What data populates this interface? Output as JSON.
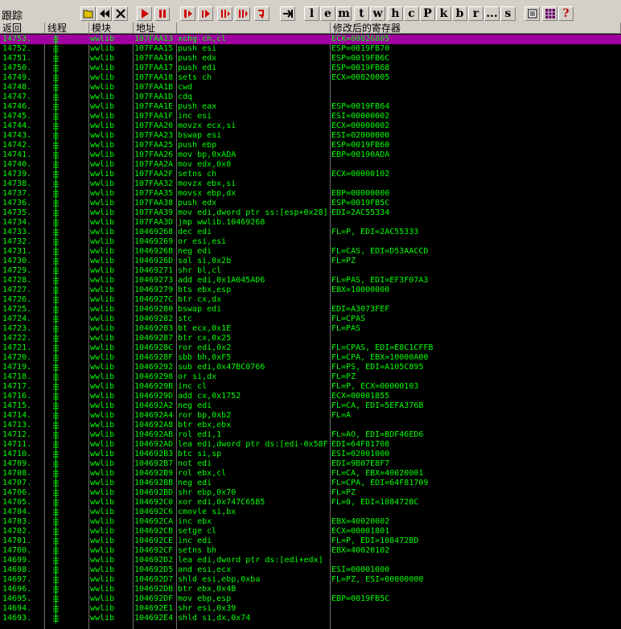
{
  "window": {
    "title": "跟踪"
  },
  "toolbar": {
    "letters": [
      "l",
      "e",
      "m",
      "t",
      "w",
      "h",
      "c",
      "P",
      "k",
      "b",
      "r",
      "...",
      "s"
    ],
    "help": "?"
  },
  "columns": {
    "index": "返回",
    "thread": "线程",
    "module": "模块",
    "address": "地址",
    "instruction": "",
    "registers": "修改后的寄存器"
  },
  "rows": [
    {
      "i": "14753.",
      "m": "wwlib",
      "a": "107FAA13",
      "ins": "xchg ch,cl",
      "reg": "ECX=00826805",
      "sel": true
    },
    {
      "i": "14752.",
      "m": "wwlib",
      "a": "107FAA15",
      "ins": "push esi",
      "reg": "ESP=0019FB70"
    },
    {
      "i": "14751.",
      "m": "wwlib",
      "a": "107FAA16",
      "ins": "push edx",
      "reg": "ESP=0019FB6C"
    },
    {
      "i": "14750.",
      "m": "wwlib",
      "a": "107FAA17",
      "ins": "push edi",
      "reg": "ESP=0019FB68"
    },
    {
      "i": "14749.",
      "m": "wwlib",
      "a": "107FAA18",
      "ins": "sets ch",
      "reg": "ECX=00820005"
    },
    {
      "i": "14748.",
      "m": "wwlib",
      "a": "107FAA1B",
      "ins": "cwd",
      "reg": ""
    },
    {
      "i": "14747.",
      "m": "wwlib",
      "a": "107FAA1D",
      "ins": "cdq",
      "reg": ""
    },
    {
      "i": "14746.",
      "m": "wwlib",
      "a": "107FAA1E",
      "ins": "push eax",
      "reg": "ESP=0019FB64"
    },
    {
      "i": "14745.",
      "m": "wwlib",
      "a": "107FAA1F",
      "ins": "inc esi",
      "reg": "ESI=00000002"
    },
    {
      "i": "14744.",
      "m": "wwlib",
      "a": "107FAA20",
      "ins": "movzx ecx,si",
      "reg": "ECX=00000002"
    },
    {
      "i": "14743.",
      "m": "wwlib",
      "a": "107FAA23",
      "ins": "bswap esi",
      "reg": "ESI=02000000"
    },
    {
      "i": "14742.",
      "m": "wwlib",
      "a": "107FAA25",
      "ins": "push ebp",
      "reg": "ESP=0019FB60"
    },
    {
      "i": "14741.",
      "m": "wwlib",
      "a": "107FAA26",
      "ins": "mov bp,0xADA",
      "reg": "EBP=00190ADA"
    },
    {
      "i": "14740.",
      "m": "wwlib",
      "a": "107FAA2A",
      "ins": "mov edx,0x0",
      "reg": ""
    },
    {
      "i": "14739.",
      "m": "wwlib",
      "a": "107FAA2F",
      "ins": "setns ch",
      "reg": "ECX=00000102"
    },
    {
      "i": "14738.",
      "m": "wwlib",
      "a": "107FAA32",
      "ins": "movzx ebx,si",
      "reg": ""
    },
    {
      "i": "14737.",
      "m": "wwlib",
      "a": "107FAA35",
      "ins": "movsx ebp,dx",
      "reg": "EBP=00000000"
    },
    {
      "i": "14736.",
      "m": "wwlib",
      "a": "107FAA38",
      "ins": "push edx",
      "reg": "ESP=0019FB5C"
    },
    {
      "i": "14735.",
      "m": "wwlib",
      "a": "107FAA39",
      "ins": "mov edi,dword ptr ss:[esp+0x28]",
      "reg": "EDI=2AC55334"
    },
    {
      "i": "14734.",
      "m": "wwlib",
      "a": "107FAA3D",
      "ins": "jmp wwlib.10469268",
      "reg": ""
    },
    {
      "i": "14733.",
      "m": "wwlib",
      "a": "10469268",
      "ins": "dec edi",
      "reg": "FL=P, EDI=2AC55333"
    },
    {
      "i": "14732.",
      "m": "wwlib",
      "a": "10469269",
      "ins": "or esi,esi",
      "reg": ""
    },
    {
      "i": "14731.",
      "m": "wwlib",
      "a": "1046926B",
      "ins": "neg edi",
      "reg": "FL=CAS, EDI=D53AACCD"
    },
    {
      "i": "14730.",
      "m": "wwlib",
      "a": "1046926D",
      "ins": "sal si,0x2b",
      "reg": "FL=PZ"
    },
    {
      "i": "14729.",
      "m": "wwlib",
      "a": "10469271",
      "ins": "shr bl,cl",
      "reg": ""
    },
    {
      "i": "14728.",
      "m": "wwlib",
      "a": "10469273",
      "ins": "add edi,0x1A045AD6",
      "reg": "FL=PAS, EDI=EF3F07A3"
    },
    {
      "i": "14727.",
      "m": "wwlib",
      "a": "10469279",
      "ins": "bts ebx,esp",
      "reg": "EBX=10000000"
    },
    {
      "i": "14726.",
      "m": "wwlib",
      "a": "1046927C",
      "ins": "btr cx,dx",
      "reg": ""
    },
    {
      "i": "14725.",
      "m": "wwlib",
      "a": "10469280",
      "ins": "bswap edi",
      "reg": "EDI=A3073FEF"
    },
    {
      "i": "14724.",
      "m": "wwlib",
      "a": "10469282",
      "ins": "stc",
      "reg": "FL=CPAS"
    },
    {
      "i": "14723.",
      "m": "wwlib",
      "a": "10469283",
      "ins": "bt ecx,0x1E",
      "reg": "FL=PAS"
    },
    {
      "i": "14722.",
      "m": "wwlib",
      "a": "10469287",
      "ins": "btr cx,0x25",
      "reg": ""
    },
    {
      "i": "14721.",
      "m": "wwlib",
      "a": "1046928C",
      "ins": "ror edi,0x2",
      "reg": "FL=CPAS, EDI=E8C1CFFB"
    },
    {
      "i": "14720.",
      "m": "wwlib",
      "a": "1046928F",
      "ins": "sbb bh,0xF5",
      "reg": "FL=CPA, EBX=10000A00"
    },
    {
      "i": "14719.",
      "m": "wwlib",
      "a": "10469292",
      "ins": "sub edi,0x47BC0766",
      "reg": "FL=PS, EDI=A105C895"
    },
    {
      "i": "14718.",
      "m": "wwlib",
      "a": "10469298",
      "ins": "or si,dx",
      "reg": "FL=PZ"
    },
    {
      "i": "14717.",
      "m": "wwlib",
      "a": "1046929B",
      "ins": "inc cl",
      "reg": "FL=P, ECX=00000103"
    },
    {
      "i": "14716.",
      "m": "wwlib",
      "a": "1046929D",
      "ins": "add cx,0x1752",
      "reg": "ECX=00001855"
    },
    {
      "i": "14715.",
      "m": "wwlib",
      "a": "104692A2",
      "ins": "neg edi",
      "reg": "FL=CA, EDI=5EFA376B"
    },
    {
      "i": "14714.",
      "m": "wwlib",
      "a": "104692A4",
      "ins": "ror bp,0xb2",
      "reg": "FL=A"
    },
    {
      "i": "14713.",
      "m": "wwlib",
      "a": "104692A8",
      "ins": "btr ebx,ebx",
      "reg": ""
    },
    {
      "i": "14712.",
      "m": "wwlib",
      "a": "104692AB",
      "ins": "rol edi,1",
      "reg": "FL=AO, EDI=BDF46ED6"
    },
    {
      "i": "14711.",
      "m": "wwlib",
      "a": "104692AD",
      "ins": "lea edi,dword ptr ds:[edi-0x58F",
      "reg": "EDI=64F81708"
    },
    {
      "i": "14710.",
      "m": "wwlib",
      "a": "104692B3",
      "ins": "btc si,sp",
      "reg": "ESI=02001000"
    },
    {
      "i": "14709.",
      "m": "wwlib",
      "a": "104692B7",
      "ins": "not edi",
      "reg": "EDI=9B07E8F7"
    },
    {
      "i": "14708.",
      "m": "wwlib",
      "a": "104692B9",
      "ins": "rol ebx,cl",
      "reg": "FL=CA, EBX=40020001"
    },
    {
      "i": "14707.",
      "m": "wwlib",
      "a": "104692BB",
      "ins": "neg edi",
      "reg": "FL=CPA, EDI=64F81709"
    },
    {
      "i": "14706.",
      "m": "wwlib",
      "a": "104692BD",
      "ins": "shr ebp,0x70",
      "reg": "FL=PZ"
    },
    {
      "i": "14705.",
      "m": "wwlib",
      "a": "104692C0",
      "ins": "xor edi,0x747C65B5",
      "reg": "FL=0, EDI=108472BC"
    },
    {
      "i": "14704.",
      "m": "wwlib",
      "a": "104692C6",
      "ins": "cmovle si,bx",
      "reg": ""
    },
    {
      "i": "14703.",
      "m": "wwlib",
      "a": "104692CA",
      "ins": "inc ebx",
      "reg": "EBX=40020002"
    },
    {
      "i": "14702.",
      "m": "wwlib",
      "a": "104692CB",
      "ins": "setge cl",
      "reg": "ECX=00001801"
    },
    {
      "i": "14701.",
      "m": "wwlib",
      "a": "104692CE",
      "ins": "inc edi",
      "reg": "FL=P, EDI=108472BD"
    },
    {
      "i": "14700.",
      "m": "wwlib",
      "a": "104692CF",
      "ins": "setns bh",
      "reg": "EBX=40020102"
    },
    {
      "i": "14699.",
      "m": "wwlib",
      "a": "104692D2",
      "ins": "lea edi,dword ptr ds:[edi+edx]",
      "reg": ""
    },
    {
      "i": "14698.",
      "m": "wwlib",
      "a": "104692D5",
      "ins": "and esi,ecx",
      "reg": "ESI=00001000"
    },
    {
      "i": "14697.",
      "m": "wwlib",
      "a": "104692D7",
      "ins": "shld esi,ebp,0xba",
      "reg": "FL=PZ, ESI=00000000"
    },
    {
      "i": "14696.",
      "m": "wwlib",
      "a": "104692DB",
      "ins": "btr ebx,0x4B",
      "reg": ""
    },
    {
      "i": "14695.",
      "m": "wwlib",
      "a": "104692DF",
      "ins": "mov ebp,esp",
      "reg": "EBP=0019FB5C"
    },
    {
      "i": "14694.",
      "m": "wwlib",
      "a": "104692E1",
      "ins": "shr esi,0x39",
      "reg": ""
    },
    {
      "i": "14693.",
      "m": "wwlib",
      "a": "104692E4",
      "ins": "shld si,dx,0x74",
      "reg": ""
    }
  ]
}
